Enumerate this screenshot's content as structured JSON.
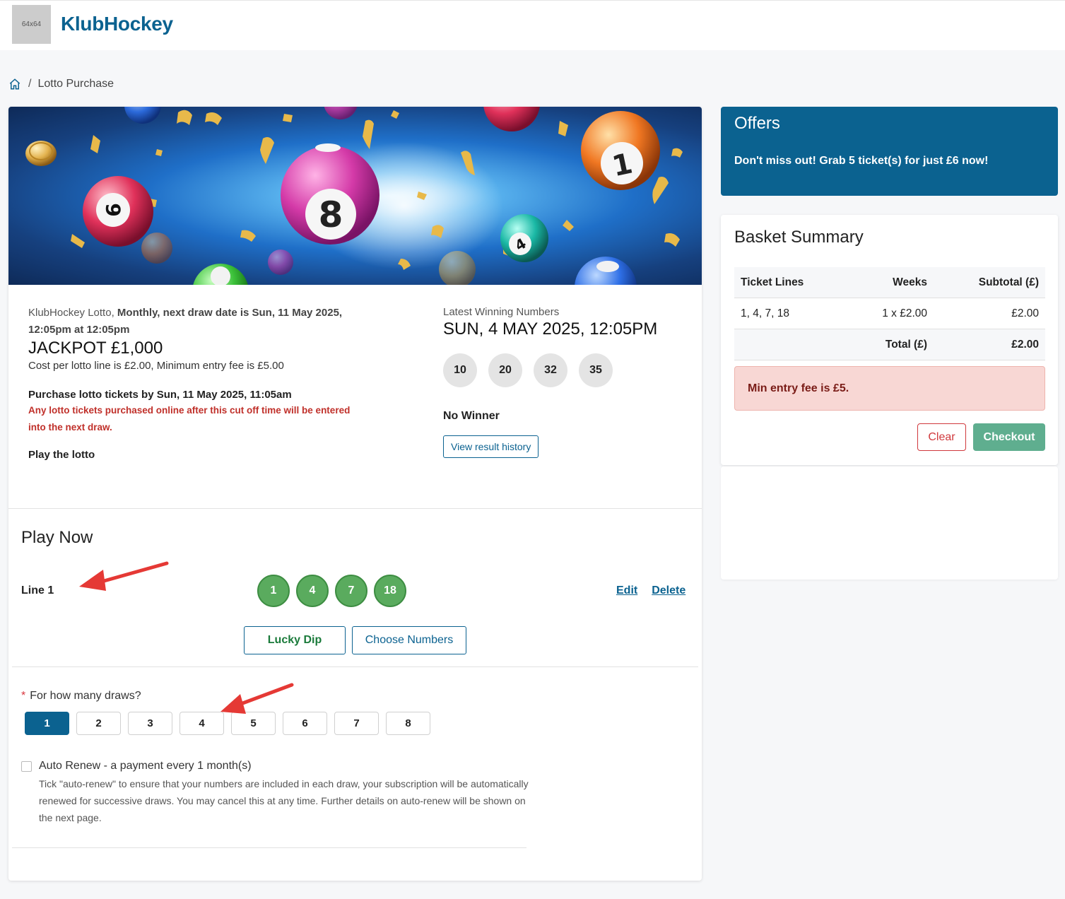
{
  "header": {
    "logo_placeholder": "64x64",
    "brand": "KlubHockey"
  },
  "breadcrumb": {
    "separator": "/",
    "current": "Lotto Purchase"
  },
  "hero": {
    "ball_numbers": [
      "6",
      "8",
      "1",
      "4"
    ]
  },
  "lotto": {
    "name": "KlubHockey Lotto,",
    "schedule": "Monthly, next draw date is Sun, 11 May 2025, 12:05pm at 12:05pm",
    "jackpot": "JACKPOT £1,000",
    "cost": "Cost per lotto line is £2.00, Minimum entry fee is £5.00",
    "purchase_by": "Purchase lotto tickets by Sun, 11 May 2025, 11:05am",
    "cutoff_warning": "Any lotto tickets purchased online after this cut off time will be entered into the next draw.",
    "play_label": "Play the lotto"
  },
  "latest": {
    "label": "Latest Winning Numbers",
    "date": "SUN, 4 MAY 2025, 12:05PM",
    "numbers": [
      "10",
      "20",
      "32",
      "35"
    ],
    "result": "No Winner",
    "history_button": "View result history"
  },
  "play_now": {
    "title": "Play Now",
    "line_label": "Line 1",
    "line_numbers": [
      "1",
      "4",
      "7",
      "18"
    ],
    "edit": "Edit",
    "delete": "Delete",
    "lucky_dip": "Lucky Dip",
    "choose_numbers": "Choose Numbers",
    "required_mark": "*",
    "draws_label": "For how many draws?",
    "draw_options": [
      "1",
      "2",
      "3",
      "4",
      "5",
      "6",
      "7",
      "8"
    ],
    "selected_draw": "1",
    "auto_renew_label": "Auto Renew - a payment every 1 month(s)",
    "auto_renew_checked": false,
    "auto_renew_help": "Tick \"auto-renew\" to ensure that your numbers are included in each draw, your subscription will be automatically renewed for successive draws. You may cancel this at any time. Further details on auto-renew will be shown on the next page."
  },
  "offers": {
    "title": "Offers",
    "text": "Don't miss out! Grab 5 ticket(s) for just £6 now!"
  },
  "basket": {
    "title": "Basket Summary",
    "columns": [
      "Ticket Lines",
      "Weeks",
      "Subtotal (£)"
    ],
    "rows": [
      {
        "lines": "1, 4, 7, 18",
        "weeks": "1 x £2.00",
        "subtotal": "£2.00"
      }
    ],
    "total_label": "Total (£)",
    "total_value": "£2.00",
    "alert": "Min entry fee is £5.",
    "clear": "Clear",
    "checkout": "Checkout"
  },
  "colors": {
    "brand": "#0b6290",
    "ball_green": "#5aab5e",
    "alert_bg": "#f8d7d4",
    "checkout": "#5fae8f",
    "annotation_arrow": "#e53935"
  }
}
